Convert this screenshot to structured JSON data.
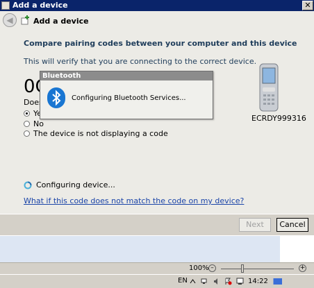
{
  "window": {
    "title": "Add a device",
    "close_glyph": "✕"
  },
  "header": {
    "title": "Add a device",
    "back_glyph": "◀"
  },
  "main": {
    "heading": "Compare pairing codes between your computer and this device",
    "subheading": "This will verify that you are connecting to the correct device.",
    "code_partial": "0C",
    "does_text": "Does",
    "options": [
      {
        "label": "Ye",
        "checked": true
      },
      {
        "label": "No",
        "checked": false
      },
      {
        "label": "The device is not displaying a code",
        "checked": false
      }
    ],
    "device_name": "ECRDY999316",
    "configuring_text": "Configuring device...",
    "help_link": "What if this code does not match the code on my device?"
  },
  "footer": {
    "next_label": "Next",
    "cancel_label": "Cancel"
  },
  "bluetooth_dialog": {
    "title": "Bluetooth",
    "message": "Configuring Bluetooth Services..."
  },
  "statusbar": {
    "zoom_label": "100%",
    "zoom_minus": "–",
    "zoom_plus": "+"
  },
  "taskbar": {
    "lang": "EN",
    "time": "14:22"
  }
}
